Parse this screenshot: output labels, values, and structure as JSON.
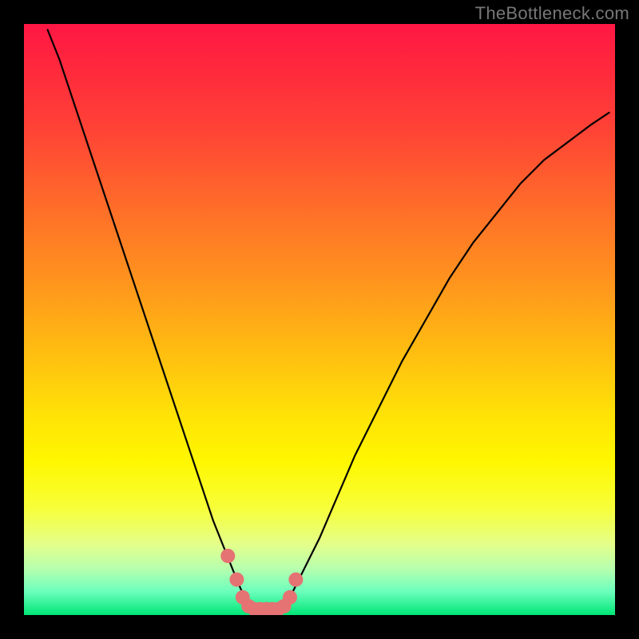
{
  "watermark": "TheBottleneck.com",
  "chart_data": {
    "type": "line",
    "title": "",
    "xlabel": "",
    "ylabel": "",
    "xlim": [
      0,
      100
    ],
    "ylim": [
      0,
      100
    ],
    "gradient_meaning": "red high to green low bottleneck",
    "series": [
      {
        "name": "bottleneck-curve",
        "color": "#000000",
        "x": [
          4,
          6,
          8,
          10,
          12,
          14,
          16,
          18,
          20,
          22,
          24,
          26,
          28,
          30,
          32,
          34,
          36,
          37.5,
          39,
          41,
          43,
          45,
          47,
          50,
          53,
          56,
          60,
          64,
          68,
          72,
          76,
          80,
          84,
          88,
          92,
          96,
          99
        ],
        "values": [
          99,
          94,
          88,
          82,
          76,
          70,
          64,
          58,
          52,
          46,
          40,
          34,
          28,
          22,
          16,
          11,
          6,
          2.5,
          1,
          1,
          1,
          3,
          7,
          13,
          20,
          27,
          35,
          43,
          50,
          57,
          63,
          68,
          73,
          77,
          80,
          83,
          85
        ]
      },
      {
        "name": "highlight-dots",
        "type": "scatter",
        "color": "#e57373",
        "x": [
          34.5,
          36,
          37,
          38,
          39,
          40,
          41,
          42,
          43,
          44,
          45,
          46
        ],
        "values": [
          10,
          6,
          3,
          1.5,
          1,
          1,
          1,
          1,
          1,
          1.5,
          3,
          6
        ]
      }
    ]
  }
}
